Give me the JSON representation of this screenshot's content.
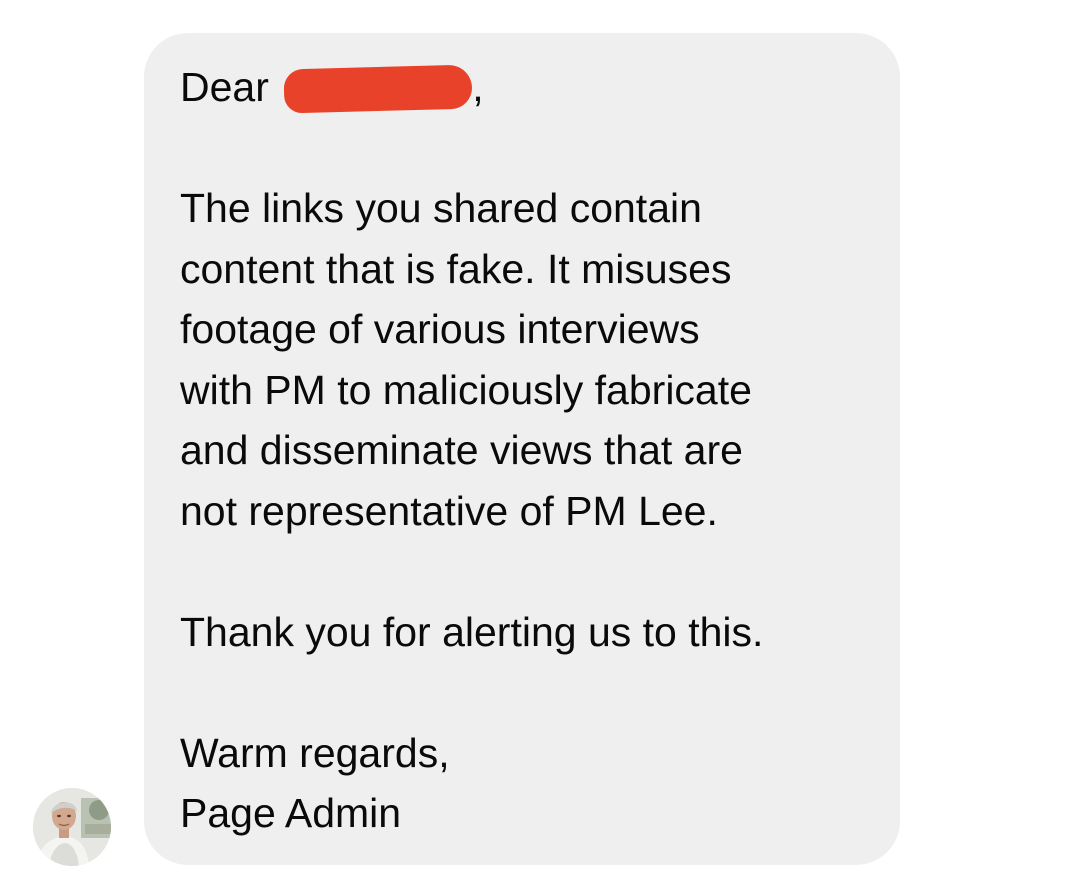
{
  "message": {
    "greeting_prefix": "Dear",
    "greeting_suffix": ",",
    "body_lines": [
      "The links you shared contain",
      "content that is fake. It misuses",
      "footage of various interviews",
      "with PM to maliciously fabricate",
      "and disseminate views that are",
      "not representative of PM Lee."
    ],
    "thanks": "Thank you for alerting us to this.",
    "closing": "Warm regards,",
    "signature": "Page Admin"
  },
  "sender": {
    "avatar_icon": "sender-profile-photo"
  },
  "colors": {
    "bubble": "#efefef",
    "redaction": "#e8432a",
    "text": "#0a0a0a"
  }
}
